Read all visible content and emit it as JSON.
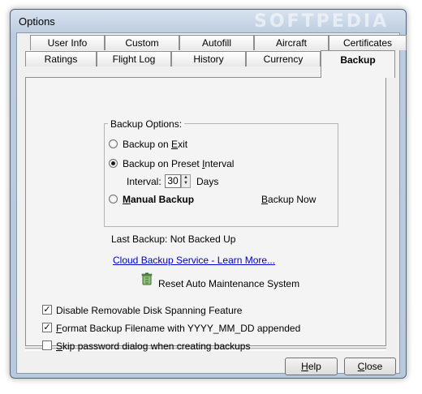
{
  "window": {
    "title": "Options",
    "watermark": "SOFTPEDIA"
  },
  "tabs_row_top": [
    {
      "label": "User Info"
    },
    {
      "label": "Custom"
    },
    {
      "label": "Autofill"
    },
    {
      "label": "Aircraft"
    },
    {
      "label": "Certificates"
    }
  ],
  "tabs_row_bottom": [
    {
      "label": "Ratings"
    },
    {
      "label": "Flight Log"
    },
    {
      "label": "History"
    },
    {
      "label": "Currency"
    },
    {
      "label": "Backup",
      "active": true
    }
  ],
  "backup_options": {
    "group_label": "Backup Options:",
    "on_exit": {
      "label": "Backup on Exit",
      "selected": false
    },
    "preset_interval": {
      "label": "Backup on Preset Interval",
      "selected": true
    },
    "interval_label": "Interval:",
    "interval_value": "30",
    "interval_unit": "Days",
    "manual": {
      "label": "Manual Backup",
      "selected": false
    },
    "backup_now_label": "Backup Now"
  },
  "last_backup": "Last Backup: Not Backed Up",
  "cloud_link": "Cloud Backup Service - Learn More...",
  "reset_label": "Reset Auto Maintenance System",
  "checkboxes": {
    "disable_spanning": {
      "label": "Disable Removable Disk Spanning Feature",
      "checked": true
    },
    "format_filename": {
      "label": "Format Backup Filename with YYYY_MM_DD appended",
      "checked": true
    },
    "skip_password": {
      "label": "Skip password dialog when creating backups",
      "checked": false
    }
  },
  "buttons": {
    "help": "Help",
    "close": "Close"
  },
  "colors": {
    "link": "#0000cc",
    "frame": "#b9c9dc"
  }
}
